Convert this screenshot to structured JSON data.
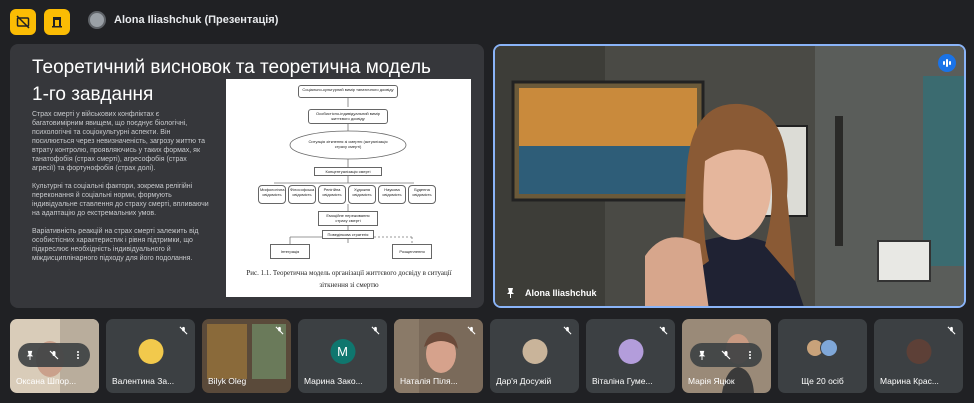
{
  "header": {
    "presenter_label": "Alona Iliashchuk (Презентація)"
  },
  "slide": {
    "title": "Теоретичний висновок та теоретична модель 1-го завдання",
    "paragraphs": [
      "Страх смерті у військових конфліктах є багатовимірним явищем, що поєднує біологічні, психологічні та соціокультурні аспекти. Він посилюється через невизначеність, загрозу життю та втрату контролю, проявляючись у таких формах, як танатофобія (страх смерті), агресофобія (страх агресії) та фортунофобія (страх долі).",
      "Культурні та соціальні фактори, зокрема релігійні переконання й соціальні норми, формують індивідуальне ставлення до страху смерті, впливаючи на адаптацію до екстремальних умов.",
      "Варіативність реакцій на страх смерті залежить від особистісних характеристик і рівня підтримки, що підкреслює необхідність індивідуального й міждисциплінарного підходу для його подолання."
    ],
    "figure": {
      "boxes": [
        "Соціально-культурний вимір танатичного досвіду",
        "Особистісно-індивідуальний вимір життєвого досвіду",
        "Ситуація зіткнення зі смертю (актуалізація страху смерті)",
        "Концептуалізація смерті",
        "Мифологічна свідомість",
        "Філософська свідомість",
        "Релігійна свідомість",
        "Художня свідомість",
        "Наукова свідомість",
        "Буденна свідомість",
        "Емоційне переживання страху смерті",
        "Поведінкова стратегія",
        "Інтеграція",
        "Розщеплення"
      ],
      "caption": "Рис. 1.1. Теоретична модель організації життєвого досвіду в ситуації зіткнення зі смертю"
    }
  },
  "main_video": {
    "name": "Alona Iliashchuk"
  },
  "participants": [
    {
      "name": "Оксана Шпор..."
    },
    {
      "name": "Валентина За..."
    },
    {
      "name": "Bilyk Oleg"
    },
    {
      "name": "Марина Зако...",
      "initial": "М"
    },
    {
      "name": "Наталія Піля..."
    },
    {
      "name": "Дар'я Досужій"
    },
    {
      "name": "Віталіна Гуме..."
    },
    {
      "name": "Марія Яцюк"
    },
    {
      "name": "Ще 20 осіб"
    },
    {
      "name": "Марина Крас..."
    }
  ],
  "colors": {
    "accent_yellow": "#fbbc04",
    "active_border": "#8ab4f8",
    "background": "#202124",
    "tile": "#3c4043",
    "avatar_teal": "#0f766e"
  },
  "icons": [
    "subtitles-off-icon",
    "present-icon",
    "pin-icon",
    "mic-off-icon",
    "audio-wave-icon",
    "more-vert-icon"
  ]
}
